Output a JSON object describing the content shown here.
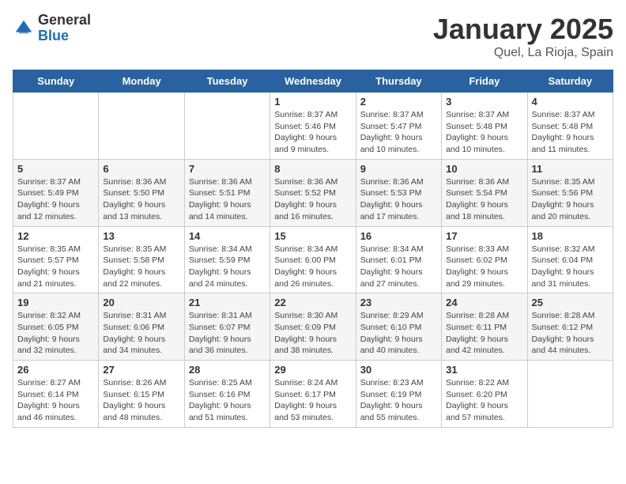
{
  "logo": {
    "general": "General",
    "blue": "Blue"
  },
  "title": "January 2025",
  "subtitle": "Quel, La Rioja, Spain",
  "weekdays": [
    "Sunday",
    "Monday",
    "Tuesday",
    "Wednesday",
    "Thursday",
    "Friday",
    "Saturday"
  ],
  "weeks": [
    [
      {
        "day": "",
        "sunrise": "",
        "sunset": "",
        "daylight": ""
      },
      {
        "day": "",
        "sunrise": "",
        "sunset": "",
        "daylight": ""
      },
      {
        "day": "",
        "sunrise": "",
        "sunset": "",
        "daylight": ""
      },
      {
        "day": "1",
        "sunrise": "Sunrise: 8:37 AM",
        "sunset": "Sunset: 5:46 PM",
        "daylight": "Daylight: 9 hours and 9 minutes."
      },
      {
        "day": "2",
        "sunrise": "Sunrise: 8:37 AM",
        "sunset": "Sunset: 5:47 PM",
        "daylight": "Daylight: 9 hours and 10 minutes."
      },
      {
        "day": "3",
        "sunrise": "Sunrise: 8:37 AM",
        "sunset": "Sunset: 5:48 PM",
        "daylight": "Daylight: 9 hours and 10 minutes."
      },
      {
        "day": "4",
        "sunrise": "Sunrise: 8:37 AM",
        "sunset": "Sunset: 5:48 PM",
        "daylight": "Daylight: 9 hours and 11 minutes."
      }
    ],
    [
      {
        "day": "5",
        "sunrise": "Sunrise: 8:37 AM",
        "sunset": "Sunset: 5:49 PM",
        "daylight": "Daylight: 9 hours and 12 minutes."
      },
      {
        "day": "6",
        "sunrise": "Sunrise: 8:36 AM",
        "sunset": "Sunset: 5:50 PM",
        "daylight": "Daylight: 9 hours and 13 minutes."
      },
      {
        "day": "7",
        "sunrise": "Sunrise: 8:36 AM",
        "sunset": "Sunset: 5:51 PM",
        "daylight": "Daylight: 9 hours and 14 minutes."
      },
      {
        "day": "8",
        "sunrise": "Sunrise: 8:36 AM",
        "sunset": "Sunset: 5:52 PM",
        "daylight": "Daylight: 9 hours and 16 minutes."
      },
      {
        "day": "9",
        "sunrise": "Sunrise: 8:36 AM",
        "sunset": "Sunset: 5:53 PM",
        "daylight": "Daylight: 9 hours and 17 minutes."
      },
      {
        "day": "10",
        "sunrise": "Sunrise: 8:36 AM",
        "sunset": "Sunset: 5:54 PM",
        "daylight": "Daylight: 9 hours and 18 minutes."
      },
      {
        "day": "11",
        "sunrise": "Sunrise: 8:35 AM",
        "sunset": "Sunset: 5:56 PM",
        "daylight": "Daylight: 9 hours and 20 minutes."
      }
    ],
    [
      {
        "day": "12",
        "sunrise": "Sunrise: 8:35 AM",
        "sunset": "Sunset: 5:57 PM",
        "daylight": "Daylight: 9 hours and 21 minutes."
      },
      {
        "day": "13",
        "sunrise": "Sunrise: 8:35 AM",
        "sunset": "Sunset: 5:58 PM",
        "daylight": "Daylight: 9 hours and 22 minutes."
      },
      {
        "day": "14",
        "sunrise": "Sunrise: 8:34 AM",
        "sunset": "Sunset: 5:59 PM",
        "daylight": "Daylight: 9 hours and 24 minutes."
      },
      {
        "day": "15",
        "sunrise": "Sunrise: 8:34 AM",
        "sunset": "Sunset: 6:00 PM",
        "daylight": "Daylight: 9 hours and 26 minutes."
      },
      {
        "day": "16",
        "sunrise": "Sunrise: 8:34 AM",
        "sunset": "Sunset: 6:01 PM",
        "daylight": "Daylight: 9 hours and 27 minutes."
      },
      {
        "day": "17",
        "sunrise": "Sunrise: 8:33 AM",
        "sunset": "Sunset: 6:02 PM",
        "daylight": "Daylight: 9 hours and 29 minutes."
      },
      {
        "day": "18",
        "sunrise": "Sunrise: 8:32 AM",
        "sunset": "Sunset: 6:04 PM",
        "daylight": "Daylight: 9 hours and 31 minutes."
      }
    ],
    [
      {
        "day": "19",
        "sunrise": "Sunrise: 8:32 AM",
        "sunset": "Sunset: 6:05 PM",
        "daylight": "Daylight: 9 hours and 32 minutes."
      },
      {
        "day": "20",
        "sunrise": "Sunrise: 8:31 AM",
        "sunset": "Sunset: 6:06 PM",
        "daylight": "Daylight: 9 hours and 34 minutes."
      },
      {
        "day": "21",
        "sunrise": "Sunrise: 8:31 AM",
        "sunset": "Sunset: 6:07 PM",
        "daylight": "Daylight: 9 hours and 36 minutes."
      },
      {
        "day": "22",
        "sunrise": "Sunrise: 8:30 AM",
        "sunset": "Sunset: 6:09 PM",
        "daylight": "Daylight: 9 hours and 38 minutes."
      },
      {
        "day": "23",
        "sunrise": "Sunrise: 8:29 AM",
        "sunset": "Sunset: 6:10 PM",
        "daylight": "Daylight: 9 hours and 40 minutes."
      },
      {
        "day": "24",
        "sunrise": "Sunrise: 8:28 AM",
        "sunset": "Sunset: 6:11 PM",
        "daylight": "Daylight: 9 hours and 42 minutes."
      },
      {
        "day": "25",
        "sunrise": "Sunrise: 8:28 AM",
        "sunset": "Sunset: 6:12 PM",
        "daylight": "Daylight: 9 hours and 44 minutes."
      }
    ],
    [
      {
        "day": "26",
        "sunrise": "Sunrise: 8:27 AM",
        "sunset": "Sunset: 6:14 PM",
        "daylight": "Daylight: 9 hours and 46 minutes."
      },
      {
        "day": "27",
        "sunrise": "Sunrise: 8:26 AM",
        "sunset": "Sunset: 6:15 PM",
        "daylight": "Daylight: 9 hours and 48 minutes."
      },
      {
        "day": "28",
        "sunrise": "Sunrise: 8:25 AM",
        "sunset": "Sunset: 6:16 PM",
        "daylight": "Daylight: 9 hours and 51 minutes."
      },
      {
        "day": "29",
        "sunrise": "Sunrise: 8:24 AM",
        "sunset": "Sunset: 6:17 PM",
        "daylight": "Daylight: 9 hours and 53 minutes."
      },
      {
        "day": "30",
        "sunrise": "Sunrise: 8:23 AM",
        "sunset": "Sunset: 6:19 PM",
        "daylight": "Daylight: 9 hours and 55 minutes."
      },
      {
        "day": "31",
        "sunrise": "Sunrise: 8:22 AM",
        "sunset": "Sunset: 6:20 PM",
        "daylight": "Daylight: 9 hours and 57 minutes."
      },
      {
        "day": "",
        "sunrise": "",
        "sunset": "",
        "daylight": ""
      }
    ]
  ]
}
